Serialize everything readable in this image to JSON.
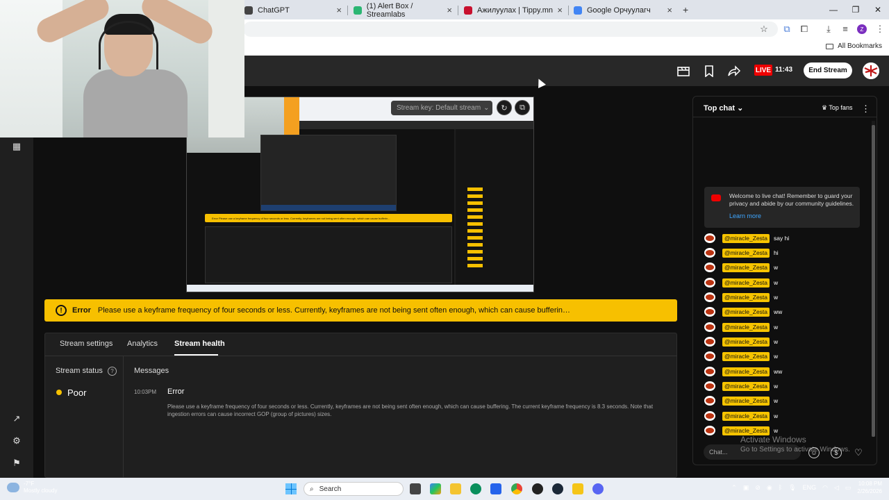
{
  "browser": {
    "tabs": [
      {
        "label": "ChatGPT",
        "color": "#444444"
      },
      {
        "label": "(1) Alert Box / Streamlabs",
        "color": "#2bb673"
      },
      {
        "label": "Ажилуулах | Tippy.mn",
        "color": "#c8102e"
      },
      {
        "label": "Google Орчуулагч",
        "color": "#4285f4"
      }
    ],
    "new_tab": "+",
    "bookmarks_label": "All Bookmarks",
    "profile_initial": "Z"
  },
  "studio": {
    "live_label": "LIVE",
    "live_time": "11:43",
    "end_stream_label": "End Stream",
    "stream_key_label": "Stream key: Default stream"
  },
  "error_banner": {
    "title": "Error",
    "message": "Please use a keyframe frequency of four seconds or less. Currently, keyframes are not being sent often enough, which can cause bufferin…"
  },
  "tabs": {
    "stream_settings": "Stream settings",
    "analytics": "Analytics",
    "stream_health": "Stream health"
  },
  "health": {
    "status_label": "Stream status",
    "status_value": "Poor",
    "status_color": "#f6c100",
    "messages_label": "Messages",
    "message": {
      "time": "10:03PM",
      "title": "Error",
      "body": "Please use a keyframe frequency of four seconds or less. Currently, keyframes are not being sent often enough, which can cause buffering. The current keyframe frequency is 8.3 seconds. Note that ingestion errors can cause incorrect GOP (group of pictures) sizes."
    }
  },
  "chat": {
    "mode_label": "Top chat",
    "top_fans_label": "Top fans",
    "welcome_text": "Welcome to live chat! Remember to guard your privacy and abide by our community guidelines.",
    "learn_more": "Learn more",
    "input_placeholder": "Chat...",
    "messages": [
      {
        "author": "@miracle_Zesta",
        "text": "say hi"
      },
      {
        "author": "@miracle_Zesta",
        "text": "hi"
      },
      {
        "author": "@miracle_Zesta",
        "text": "w"
      },
      {
        "author": "@miracle_Zesta",
        "text": "w"
      },
      {
        "author": "@miracle_Zesta",
        "text": "w"
      },
      {
        "author": "@miracle_Zesta",
        "text": "ww"
      },
      {
        "author": "@miracle_Zesta",
        "text": "w"
      },
      {
        "author": "@miracle_Zesta",
        "text": "w"
      },
      {
        "author": "@miracle_Zesta",
        "text": "w"
      },
      {
        "author": "@miracle_Zesta",
        "text": "ww"
      },
      {
        "author": "@miracle_Zesta",
        "text": "w"
      },
      {
        "author": "@miracle_Zesta",
        "text": "w"
      },
      {
        "author": "@miracle_Zesta",
        "text": "w"
      },
      {
        "author": "@miracle_Zesta",
        "text": "w"
      }
    ]
  },
  "watermark": {
    "line1": "Activate Windows",
    "line2": "Go to Settings to activate Windows."
  },
  "taskbar": {
    "weather_temp": "-7°F",
    "weather_desc": "Mostly cloudy",
    "search_label": "Search",
    "lang": "ENG",
    "time": "10:08 PM",
    "date": "2/26/2026"
  },
  "preview": {
    "error_text": "Error   Please use a keyframe frequency of four seconds or less. Currently, keyframes are not being sent often enough, which can cause bufferin..."
  }
}
